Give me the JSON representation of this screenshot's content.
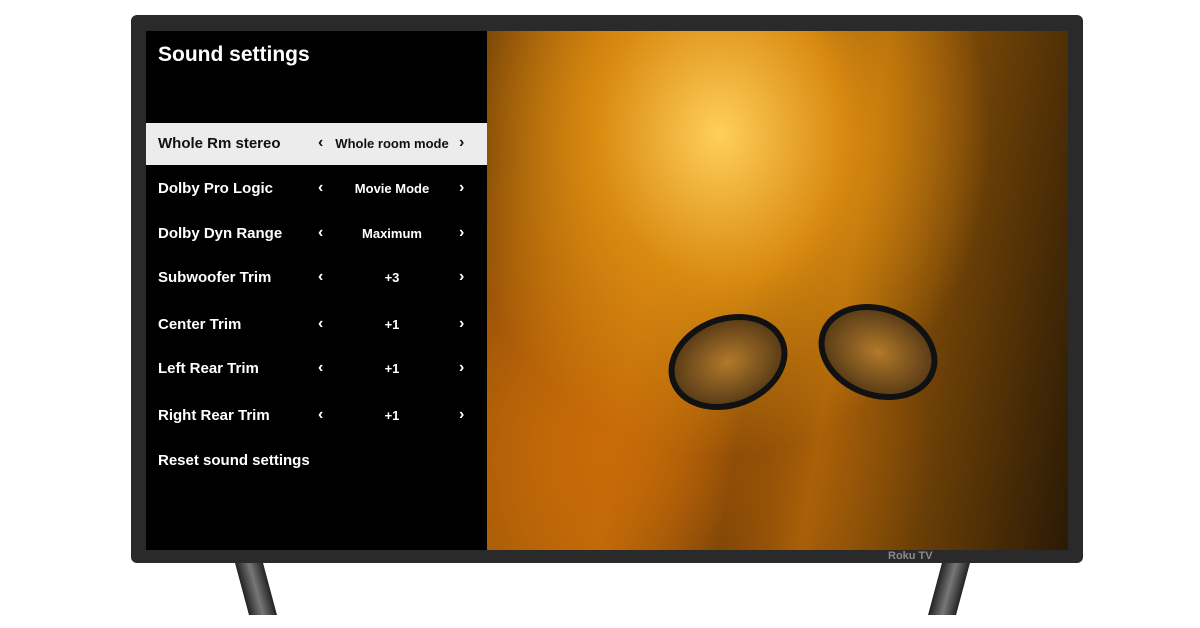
{
  "menu": {
    "title": "Sound settings",
    "items": [
      {
        "label": "Whole Rm stereo",
        "value": "Whole room mode",
        "selected": true
      },
      {
        "label": "Dolby Pro Logic",
        "value": "Movie Mode"
      },
      {
        "label": "Dolby Dyn Range",
        "value": "Maximum"
      },
      {
        "label": "Subwoofer Trim",
        "value": "+3"
      },
      {
        "label": "Center Trim",
        "value": "+1"
      },
      {
        "label": "Left Rear Trim",
        "value": "+1"
      },
      {
        "label": "Right Rear Trim",
        "value": "+1"
      }
    ],
    "reset": "Reset sound settings",
    "prev_glyph": "‹",
    "next_glyph": "›"
  },
  "brand": "Roku TV"
}
